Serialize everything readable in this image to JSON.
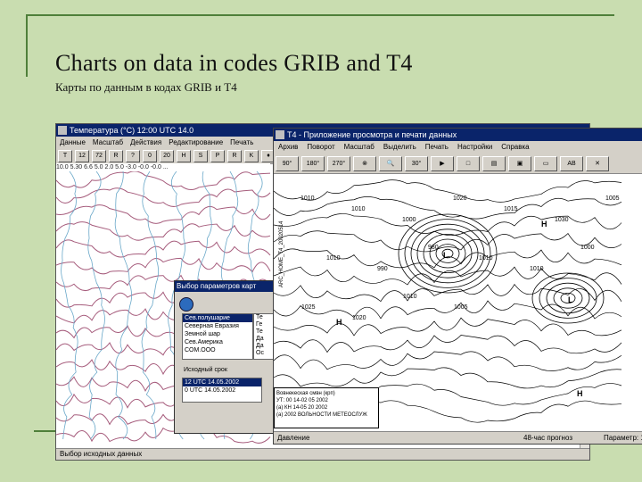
{
  "slide": {
    "title": "Charts on data in codes GRIB and T4",
    "subtitle": "Карты по данным в кодах GRIB и T4"
  },
  "window1": {
    "title": "Температура  (°C)           12:00 UTC    14.0",
    "menu": [
      "Данные",
      "Масштаб",
      "Действия",
      "Редактирование",
      "Печать"
    ],
    "toolbar": [
      "T",
      "12",
      "72",
      "R",
      "?",
      "0",
      "20",
      "H",
      "S",
      "P",
      "R",
      "K",
      "♦",
      "⌂"
    ],
    "strip_values": "10.0  5.30  6.6  5.0  2.0  5.0  -3.0  -0.0  -0.0  ...",
    "status": "Выбор исходных данных"
  },
  "dialog": {
    "title": "Выбор параметров карт",
    "regions": [
      "Сев.полушарие",
      "Северная Евразия",
      "Земной шар",
      "Сев.Америка",
      "COM.OOO"
    ],
    "selected_region": "Сев.полушарие",
    "source_label": "Исходный срок",
    "source_times": [
      "12 UTC 14.05.2002",
      "0 UTC 14.05.2002"
    ],
    "selected_time": "12 UTC 14.05.2002",
    "param_col": [
      "Те",
      "Ге",
      "Те",
      "Да",
      "Да",
      "Ос"
    ]
  },
  "window2": {
    "title": "T4 - Приложение просмотра и печати данных",
    "menu": [
      "Архив",
      "Поворот",
      "Масштаб",
      "Выделить",
      "Печать",
      "Настройки",
      "Справка"
    ],
    "toolbar": [
      "90°",
      "180°",
      "270°",
      "⊗",
      "🔍",
      "30°",
      "▶",
      "□",
      "▤",
      "▣",
      "▭",
      "AB",
      "✕"
    ],
    "side_label": "ARC_HOME_T4_20020514",
    "legend": [
      "Вовнекеская смвн (крп)",
      "УТ: 00 14-02 05 2002",
      "(а) КН 14-05 20 2002",
      "(а) 2002 ВОЛЬНОСТИ МЕТЕОСЛУЖ"
    ],
    "status": {
      "left": "Давление",
      "middle": "48-час прогноз",
      "right": "Параметр: 1"
    },
    "pressure_labels": [
      "1010",
      "1010",
      "1000",
      "1020",
      "1015",
      "1030",
      "1005",
      "1010",
      "990",
      "980",
      "1010",
      "1010",
      "1000",
      "1025",
      "1020",
      "1010",
      "1005"
    ],
    "highs": [
      "H",
      "H",
      "H"
    ],
    "lows": [
      "L",
      "L"
    ]
  },
  "colors": {
    "background": "#c9ddb0",
    "accent": "#4f7f3a",
    "titlebar": "#0a246a",
    "isoline": "#a65c7c"
  }
}
